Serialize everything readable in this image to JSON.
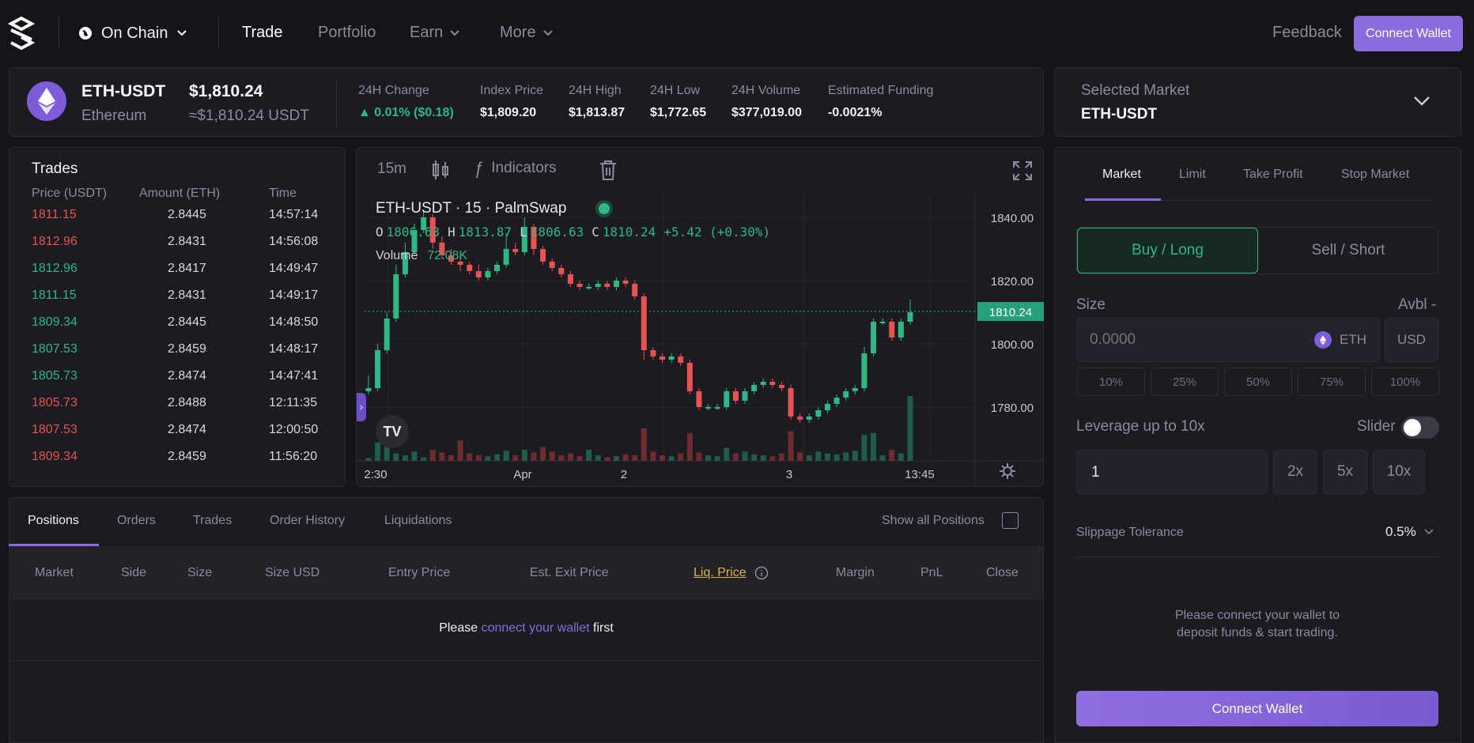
{
  "nav": {
    "chain": "On Chain",
    "items": [
      {
        "label": "Trade",
        "active": true
      },
      {
        "label": "Portfolio",
        "active": false
      },
      {
        "label": "Earn",
        "active": false
      },
      {
        "label": "More",
        "active": false
      }
    ],
    "feedback": "Feedback",
    "connect_wallet": "Connect Wallet"
  },
  "market": {
    "pair": "ETH-USDT",
    "name": "Ethereum",
    "price": "$1,810.24",
    "price_usdt": "≈$1,810.24 USDT",
    "stats": [
      {
        "label": "24H Change",
        "value": "▲ 0.01% ($0.18)"
      },
      {
        "label": "Index Price",
        "value": "$1,809.20"
      },
      {
        "label": "24H High",
        "value": "$1,813.87"
      },
      {
        "label": "24H Low",
        "value": "$1,772.65"
      },
      {
        "label": "24H Volume",
        "value": "$377,019.00"
      },
      {
        "label": "Estimated Funding",
        "value": "-0.0021%"
      }
    ]
  },
  "selected_market": {
    "label": "Selected Market",
    "value": "ETH-USDT"
  },
  "trades": {
    "title": "Trades",
    "headers": [
      "Price (USDT)",
      "Amount (ETH)",
      "Time"
    ],
    "rows": [
      {
        "price": "1811.15",
        "amount": "2.8445",
        "time": "14:57:14",
        "side": "sell"
      },
      {
        "price": "1812.96",
        "amount": "2.8431",
        "time": "14:56:08",
        "side": "sell"
      },
      {
        "price": "1812.96",
        "amount": "2.8417",
        "time": "14:49:47",
        "side": "buy"
      },
      {
        "price": "1811.15",
        "amount": "2.8431",
        "time": "14:49:17",
        "side": "buy"
      },
      {
        "price": "1809.34",
        "amount": "2.8445",
        "time": "14:48:50",
        "side": "buy"
      },
      {
        "price": "1807.53",
        "amount": "2.8459",
        "time": "14:48:17",
        "side": "buy"
      },
      {
        "price": "1805.73",
        "amount": "2.8474",
        "time": "14:47:41",
        "side": "buy"
      },
      {
        "price": "1805.73",
        "amount": "2.8488",
        "time": "12:11:35",
        "side": "sell"
      },
      {
        "price": "1807.53",
        "amount": "2.8474",
        "time": "12:00:50",
        "side": "sell"
      },
      {
        "price": "1809.34",
        "amount": "2.8459",
        "time": "11:56:20",
        "side": "sell"
      }
    ]
  },
  "chart": {
    "interval": "15m",
    "indicators": "Indicators",
    "legend_title": "ETH-USDT · 15 · PalmSwap",
    "ohlc": {
      "o": "1806.63",
      "h": "1813.87",
      "l": "1806.63",
      "c": "1810.24",
      "change": "+5.42 (+0.30%)"
    },
    "volume_label": "Volume",
    "volume_value": "72.08K",
    "price_ticks": [
      "1840.00",
      "1820.00",
      "1800.00",
      "1780.00"
    ],
    "last_price": "1810.24",
    "time_ticks": [
      "2:30",
      "Apr",
      "2",
      "3",
      "13:45"
    ],
    "y_range": [
      1763,
      1848
    ],
    "candles": [
      [
        1785,
        1790,
        1784,
        1786
      ],
      [
        1786,
        1800,
        1785,
        1798
      ],
      [
        1798,
        1810,
        1797,
        1808
      ],
      [
        1808,
        1825,
        1807,
        1822
      ],
      [
        1822,
        1832,
        1821,
        1829
      ],
      [
        1829,
        1838,
        1828,
        1836
      ],
      [
        1836,
        1842,
        1835,
        1840
      ],
      [
        1840,
        1841,
        1830,
        1832
      ],
      [
        1832,
        1834,
        1827,
        1828
      ],
      [
        1828,
        1830,
        1825,
        1826
      ],
      [
        1826,
        1828,
        1823,
        1825
      ],
      [
        1825,
        1826,
        1822,
        1823
      ],
      [
        1823,
        1825,
        1820,
        1821
      ],
      [
        1821,
        1824,
        1820,
        1823
      ],
      [
        1823,
        1826,
        1822,
        1825
      ],
      [
        1825,
        1835,
        1824,
        1830
      ],
      [
        1830,
        1832,
        1828,
        1829
      ],
      [
        1829,
        1840,
        1828,
        1837
      ],
      [
        1837,
        1838,
        1828,
        1830
      ],
      [
        1830,
        1831,
        1825,
        1826
      ],
      [
        1826,
        1827,
        1823,
        1824
      ],
      [
        1824,
        1825,
        1821,
        1822
      ],
      [
        1822,
        1823,
        1818,
        1819
      ],
      [
        1819,
        1820,
        1817,
        1818
      ],
      [
        1818,
        1819,
        1817,
        1818
      ],
      [
        1818,
        1820,
        1817,
        1819
      ],
      [
        1819,
        1820,
        1817,
        1818
      ],
      [
        1818,
        1821,
        1817,
        1820
      ],
      [
        1820,
        1821,
        1818,
        1819
      ],
      [
        1819,
        1820,
        1814,
        1815
      ],
      [
        1815,
        1816,
        1795,
        1798
      ],
      [
        1798,
        1799,
        1795,
        1796
      ],
      [
        1796,
        1797,
        1794,
        1795
      ],
      [
        1795,
        1797,
        1794,
        1796
      ],
      [
        1796,
        1797,
        1793,
        1794
      ],
      [
        1794,
        1795,
        1784,
        1785
      ],
      [
        1785,
        1786,
        1779,
        1780
      ],
      [
        1780,
        1781,
        1779,
        1780
      ],
      [
        1780,
        1781,
        1779,
        1780
      ],
      [
        1780,
        1786,
        1779,
        1785
      ],
      [
        1785,
        1786,
        1781,
        1782
      ],
      [
        1782,
        1786,
        1781,
        1785
      ],
      [
        1785,
        1788,
        1784,
        1787
      ],
      [
        1787,
        1789,
        1786,
        1788
      ],
      [
        1788,
        1789,
        1786,
        1787
      ],
      [
        1787,
        1788,
        1785,
        1786
      ],
      [
        1786,
        1787,
        1776,
        1777
      ],
      [
        1777,
        1778,
        1775,
        1776
      ],
      [
        1776,
        1778,
        1775,
        1777
      ],
      [
        1777,
        1780,
        1776,
        1779
      ],
      [
        1779,
        1782,
        1778,
        1781
      ],
      [
        1781,
        1784,
        1780,
        1783
      ],
      [
        1783,
        1786,
        1782,
        1785
      ],
      [
        1785,
        1787,
        1784,
        1786
      ],
      [
        1786,
        1799,
        1785,
        1797
      ],
      [
        1797,
        1808,
        1796,
        1807
      ],
      [
        1807,
        1808,
        1806,
        1807
      ],
      [
        1807,
        1808,
        1801,
        1802
      ],
      [
        1802,
        1808,
        1801,
        1807
      ],
      [
        1807,
        1814,
        1806,
        1810
      ]
    ],
    "volumes": [
      3,
      20,
      15,
      8,
      6,
      10,
      4,
      12,
      9,
      6,
      22,
      8,
      6,
      5,
      7,
      11,
      6,
      12,
      9,
      15,
      10,
      6,
      8,
      5,
      12,
      6,
      4,
      5,
      7,
      6,
      35,
      10,
      6,
      5,
      8,
      30,
      9,
      6,
      5,
      14,
      8,
      10,
      7,
      6,
      5,
      8,
      32,
      9,
      6,
      10,
      8,
      7,
      9,
      11,
      28,
      30,
      6,
      12,
      8,
      70
    ]
  },
  "order": {
    "tabs": [
      "Market",
      "Limit",
      "Take Profit",
      "Stop Market"
    ],
    "buy": "Buy / Long",
    "sell": "Sell / Short",
    "size_label": "Size",
    "avbl": "Avbl -",
    "size_placeholder": "0.0000",
    "token": "ETH",
    "usd": "USD",
    "pcts": [
      "10%",
      "25%",
      "50%",
      "75%",
      "100%"
    ],
    "leverage_label": "Leverage up to 10x",
    "slider_label": "Slider",
    "leverage_value": "1",
    "lev_buttons": [
      "2x",
      "5x",
      "10x"
    ],
    "slippage_label": "Slippage Tolerance",
    "slippage_value": "0.5%",
    "connect_msg_1": "Please connect your wallet to",
    "connect_msg_2": "deposit funds & start trading.",
    "connect_wallet": "Connect Wallet"
  },
  "positions": {
    "tabs": [
      "Positions",
      "Orders",
      "Trades",
      "Order History",
      "Liquidations"
    ],
    "show_all": "Show all Positions",
    "columns": [
      "Market",
      "Side",
      "Size",
      "Size USD",
      "Entry Price",
      "Est. Exit Price",
      "Liq. Price",
      "Margin",
      "PnL",
      "Close"
    ],
    "empty_pre": "Please",
    "empty_link": "connect your wallet",
    "empty_post": "first"
  },
  "colors": {
    "accent": "#8a6cdc",
    "green": "#2fb785",
    "red": "#e55353"
  }
}
